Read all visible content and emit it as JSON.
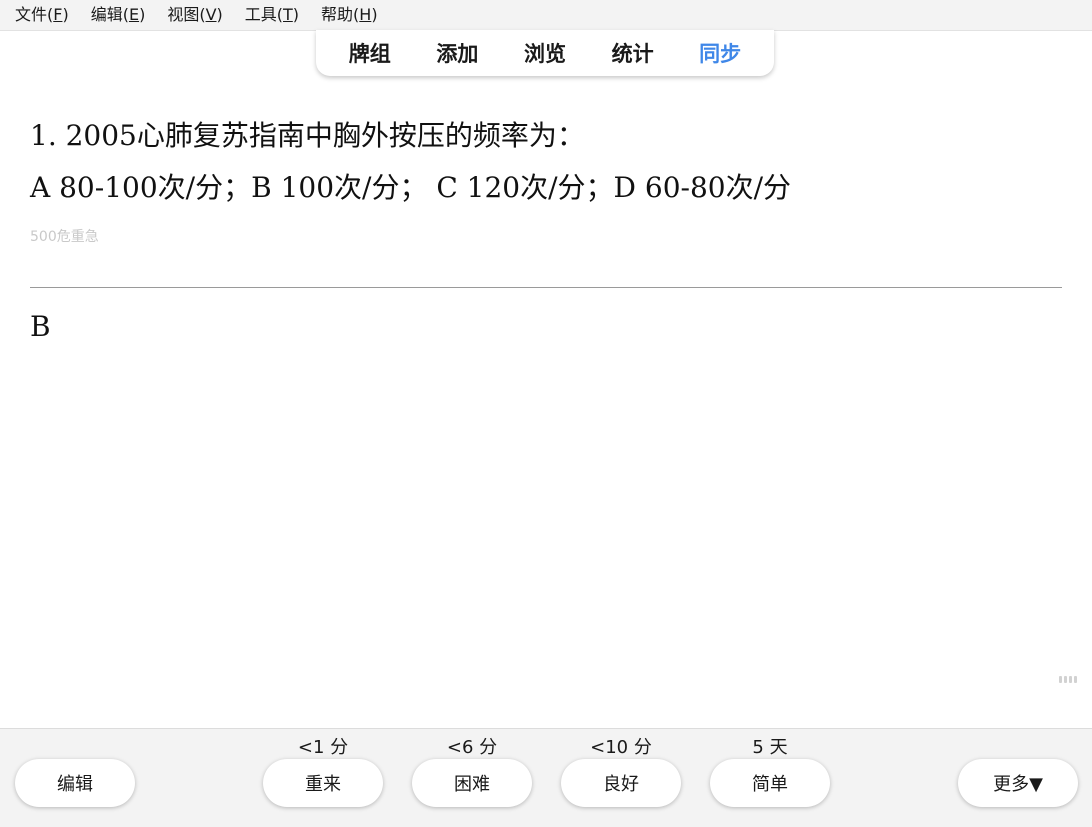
{
  "menu": [
    {
      "label": "文件(",
      "key": "F",
      "close": ")"
    },
    {
      "label": "编辑(",
      "key": "E",
      "close": ")"
    },
    {
      "label": "视图(",
      "key": "V",
      "close": ")"
    },
    {
      "label": "工具(",
      "key": "T",
      "close": ")"
    },
    {
      "label": "帮助(",
      "key": "H",
      "close": ")"
    }
  ],
  "nav": {
    "decks": "牌组",
    "add": "添加",
    "browse": "浏览",
    "stats": "统计",
    "sync": "同步",
    "active_color": "#3f87e8"
  },
  "card": {
    "question": "1. 2005心肺复苏指南中胸外按压的频率为：",
    "options": "A  80-100次/分；B  100次/分；  C  120次/分；D  60-80次/分",
    "tag": "500危重急",
    "answer": "B"
  },
  "bottom": {
    "edit": "编辑",
    "more": "更多▼",
    "answers": [
      {
        "interval": "<1 分",
        "label": "重来"
      },
      {
        "interval": "<6 分",
        "label": "困难"
      },
      {
        "interval": "<10 分",
        "label": "良好"
      },
      {
        "interval": "5 天",
        "label": "简单"
      }
    ]
  }
}
